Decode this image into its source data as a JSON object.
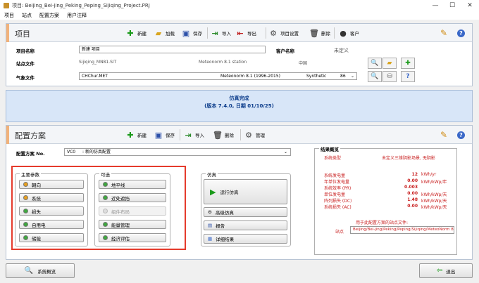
{
  "window": {
    "title": "项目: Beijing_Bei-jing_Peking_Peping_Sijiqing_Project.PRJ",
    "min": "—",
    "max": "☐",
    "close": "✕"
  },
  "menu": [
    "项目",
    "站点",
    "配置方案",
    "用户注释"
  ],
  "project": {
    "title": "项目",
    "toolbar": {
      "new": "新建",
      "load": "加载",
      "save": "保存",
      "import": "导入",
      "export": "导出",
      "settings": "项目设置",
      "delete": "删除",
      "client": "客户"
    },
    "name_label": "项目名称",
    "name_value": "新建 项目",
    "client_label": "客户名称",
    "client_value": "未定义",
    "site_label": "站点文件",
    "site_file": "Sijiqing_MN81.SIT",
    "site_source": "Meteonorm 8.1 station",
    "site_country": "中国",
    "meteo_label": "气象文件",
    "meteo_file": "CHChur.MET",
    "meteo_source": "Meteonorm 8.1 (1996-2015)",
    "meteo_type": "Synthetic",
    "meteo_num": "86"
  },
  "sim_status": {
    "line1": "仿真完成",
    "line2": "(版本 7.4.0, 日期 01/10/25)"
  },
  "variant": {
    "title": "配置方案",
    "toolbar": {
      "new": "新建",
      "save": "保存",
      "import": "导入",
      "delete": "删除",
      "manage": "管理"
    },
    "no_label": "配置方案 No.",
    "no_code": "VC0",
    "no_name": ": 新的仿真配置",
    "main_params_title": "主要参数",
    "main_params": [
      "朝向",
      "系统",
      "损失",
      "自用电",
      "储能"
    ],
    "optional_title": "可选",
    "optional": [
      "地平线",
      "近处遮挡",
      "组件布局",
      "能量管理",
      "经济评估"
    ],
    "sim_title": "仿真",
    "run_label": "运行仿真",
    "advanced": "高级仿真",
    "report": "报告",
    "detailed": "详细结果"
  },
  "results": {
    "title": "结果概览",
    "type_label": "系统类型",
    "type_value": "未定义三维阴影场景, 无阴影",
    "rows": [
      {
        "label": "系统发电量",
        "value": "12",
        "unit": "kWh/yr"
      },
      {
        "label": "年单位发电量",
        "value": "0.00",
        "unit": "kWh/kWp/年"
      },
      {
        "label": "系统效率 (PR)",
        "value": "0.003",
        "unit": ""
      },
      {
        "label": "单位发电量",
        "value": "0.00",
        "unit": "kWh/kWp/天"
      },
      {
        "label": "阵列损失 (DC)",
        "value": "1.48",
        "unit": "kWh/kWp/天"
      },
      {
        "label": "系统损失 (AC)",
        "value": "0.00",
        "unit": "kWh/kWp/天"
      }
    ],
    "site_note": "用于此配置方案的站点文件:",
    "site_label": "站点",
    "site_value": "Beijing/Bei-jing/Peking/Peping/Sijiqing/MeteoNorm 8.1 s"
  },
  "bottom": {
    "overview": "系统概览",
    "exit": "退出"
  }
}
